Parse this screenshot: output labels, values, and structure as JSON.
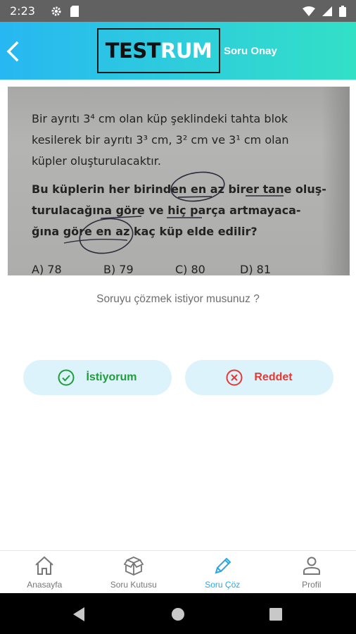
{
  "status": {
    "time": "2:23"
  },
  "appbar": {
    "logo_part1": "TEST",
    "logo_part2": "RUM",
    "subtitle": "Soru Onay"
  },
  "question": {
    "line1": "Bir ayrıtı 3⁴ cm olan küp şeklindeki tahta blok",
    "line2": "kesilerek bir ayrıtı 3³ cm, 3² cm ve 3¹ cm olan",
    "line3": "küpler oluşturulacaktır.",
    "line4": "Bu küplerin her birinden en az birer tane oluş-",
    "line5": "turulacağına göre ve hiç parça artmayaca-",
    "line6": "ğına göre en az kaç küp elde edilir?",
    "options": [
      "A) 78",
      "B) 79",
      "C) 80",
      "D) 81"
    ]
  },
  "prompt": "Soruyu çözmek istiyor musunuz ?",
  "actions": {
    "accept": "İstiyorum",
    "reject": "Reddet"
  },
  "colors": {
    "accept": "#1f9d3b",
    "reject": "#e53935",
    "active_tab": "#2aa6e8",
    "button_bg": "#ddf3fb"
  },
  "nav": [
    {
      "label": "Anasayfa",
      "icon": "home-icon"
    },
    {
      "label": "Soru Kutusu",
      "icon": "box-icon"
    },
    {
      "label": "Soru Çöz",
      "icon": "pencil-icon"
    },
    {
      "label": "Profil",
      "icon": "person-icon"
    }
  ]
}
